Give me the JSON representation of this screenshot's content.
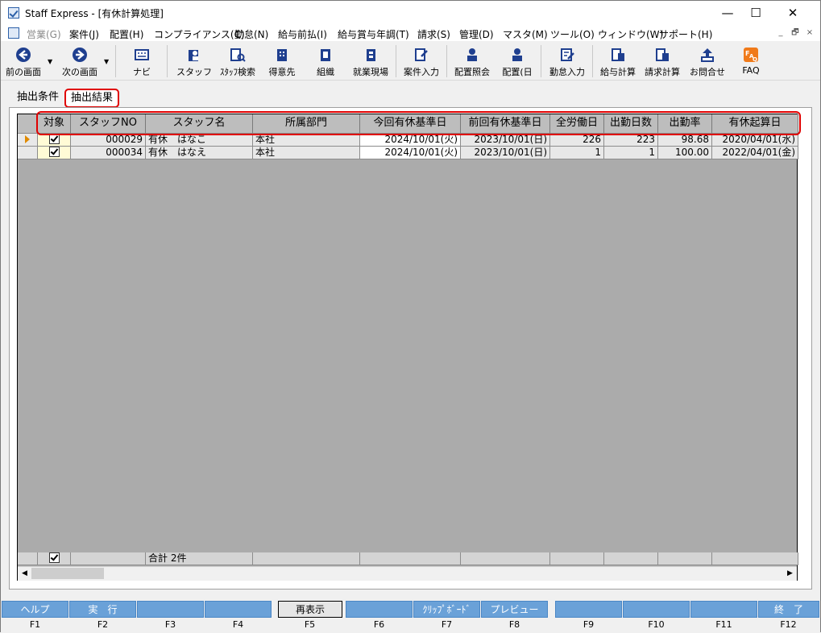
{
  "window": {
    "title": "Staff Express - [有休計算処理]",
    "min": "—",
    "max": "☐",
    "close": "✕"
  },
  "menu": [
    {
      "label": "営業(G)",
      "disabled": true
    },
    {
      "label": "案件(J)"
    },
    {
      "label": "配置(H)"
    },
    {
      "label": "コンプライアンス(C)"
    },
    {
      "label": "勤怠(N)"
    },
    {
      "label": "給与前払(I)"
    },
    {
      "label": "給与賞与年調(T)"
    },
    {
      "label": "請求(S)"
    },
    {
      "label": "管理(D)"
    },
    {
      "label": "マスタ(M)"
    },
    {
      "label": "ツール(O)"
    },
    {
      "label": "ウィンドウ(W)"
    },
    {
      "label": "サポート(H)"
    }
  ],
  "mdi": {
    "min": "_",
    "restore": "🗗",
    "close": "×"
  },
  "toolbar": {
    "prev": "前の画面",
    "next": "次の画面",
    "navi": "ナビ",
    "staff": "スタッフ",
    "staff_search": "ｽﾀｯﾌ検索",
    "client": "得意先",
    "org": "組織",
    "site": "就業現場",
    "case_input": "案件入力",
    "placement_inquiry": "配置照会",
    "placement_day": "配置(日",
    "attendance": "勤怠入力",
    "payroll": "給与計算",
    "billing": "請求計算",
    "contact": "お問合せ",
    "faq": "FAQ"
  },
  "tabs": {
    "criteria": "抽出条件",
    "results": "抽出結果"
  },
  "grid": {
    "headers": [
      "対象",
      "スタッフNO",
      "スタッフ名",
      "所属部門",
      "今回有休基準日",
      "前回有休基準日",
      "全労働日",
      "出勤日数",
      "出勤率",
      "有休起算日"
    ],
    "rows": [
      {
        "no": "000029",
        "name": "有休　はなこ",
        "dept": "本社",
        "cur": "2024/10/01(火)",
        "prev": "2023/10/01(日)",
        "all": "226",
        "days": "223",
        "rate": "98.68",
        "start": "2020/04/01(水)"
      },
      {
        "no": "000034",
        "name": "有休　はなえ",
        "dept": "本社",
        "cur": "2024/10/01(火)",
        "prev": "2023/10/01(日)",
        "all": "1",
        "days": "1",
        "rate": "100.00",
        "start": "2022/04/01(金)"
      }
    ],
    "total": "合計 2件"
  },
  "fkeys": [
    {
      "label": "ヘルプ",
      "key": "F1"
    },
    {
      "label": "実　行",
      "key": "F2"
    },
    {
      "label": "",
      "key": "F3"
    },
    {
      "label": "",
      "key": "F4"
    },
    {
      "label": "再表示",
      "key": "F5"
    },
    {
      "label": "",
      "key": "F6"
    },
    {
      "label": "ｸﾘｯﾌﾟﾎﾞｰﾄﾞ",
      "key": "F7"
    },
    {
      "label": "プレビュー",
      "key": "F8"
    },
    {
      "label": "",
      "key": "F9"
    },
    {
      "label": "",
      "key": "F10"
    },
    {
      "label": "",
      "key": "F11"
    },
    {
      "label": "終　了",
      "key": "F12"
    }
  ]
}
